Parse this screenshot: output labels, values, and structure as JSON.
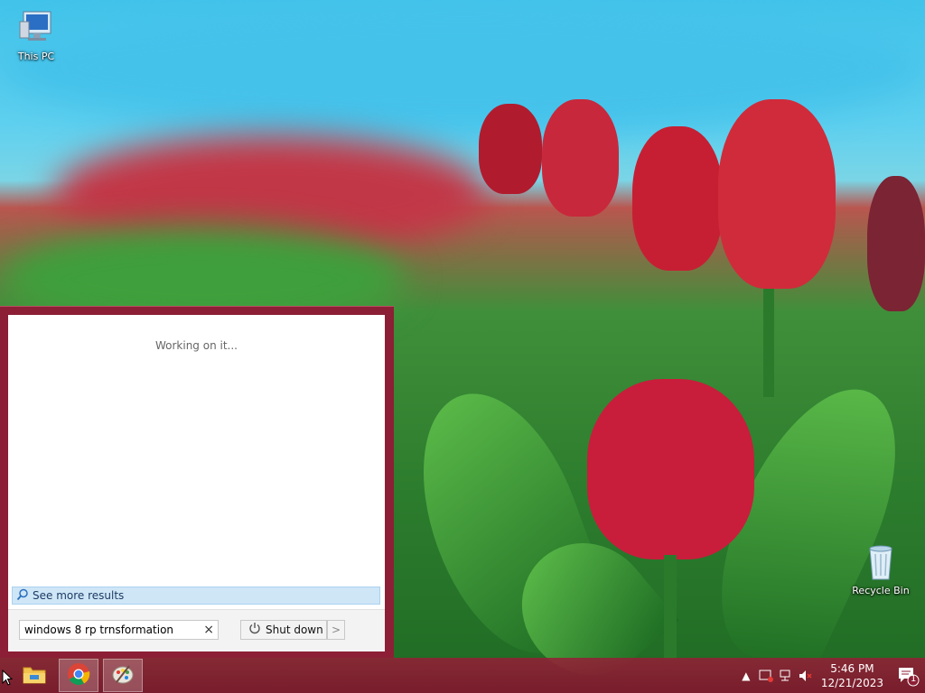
{
  "desktop": {
    "icons": [
      {
        "label": "This PC",
        "icon": "this-pc-icon"
      },
      {
        "label": "Recycle Bin",
        "icon": "recycle-bin-icon"
      }
    ]
  },
  "start_search": {
    "status_text": "Working on it...",
    "see_more_label": "See more results",
    "search_value": "windows 8 rp trnsformation",
    "clear_glyph": "×",
    "shutdown_label": "Shut down",
    "shutdown_arrow": ">",
    "accent_color": "#8c1f35"
  },
  "taskbar": {
    "pinned": [
      {
        "name": "file-explorer-icon"
      },
      {
        "name": "chrome-icon"
      },
      {
        "name": "paint-icon"
      }
    ],
    "tray": {
      "time": "5:46 PM",
      "date": "12/21/2023",
      "notification_count": "1"
    }
  }
}
